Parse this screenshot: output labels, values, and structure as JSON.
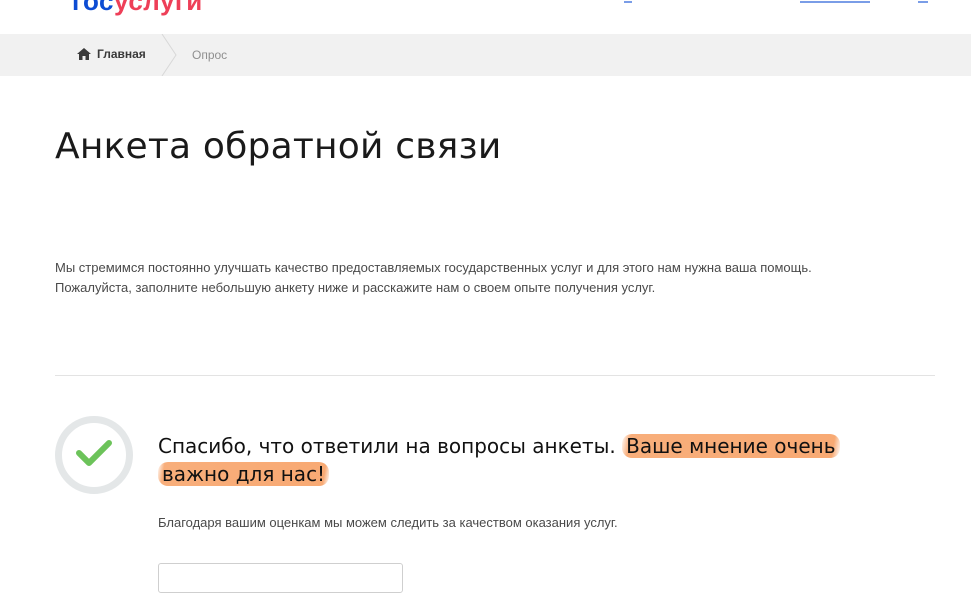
{
  "header": {
    "logo_part1": "гос",
    "logo_part2": "услуги"
  },
  "breadcrumb": {
    "home_label": "Главная",
    "current_label": "Опрос"
  },
  "main": {
    "title": "Анкета обратной связи",
    "intro_line1": "Мы стремимся постоянно улучшать качество предоставляемых государственных услуг и для этого нам нужна ваша помощь.",
    "intro_line2": "Пожалуйста, заполните небольшую анкету ниже и расскажите нам о своем опыте получения услуг."
  },
  "success": {
    "heading_plain": "Спасибо, что ответили на вопросы анкеты. ",
    "heading_highlight_1": "Ваше мнение очень",
    "heading_highlight_2": "важно для нас!",
    "subtext": "Благодаря вашим оценкам мы можем следить за качеством оказания услуг."
  },
  "icons": {
    "home": "home-icon",
    "check": "check-icon",
    "separator": "chevron-right-icon"
  },
  "colors": {
    "brand_blue": "#0d4cd3",
    "brand_red": "#ee3f58",
    "check_green": "#6cc35a",
    "highlight_orange": "#f7a064",
    "breadcrumb_bg": "#f1f1f1"
  }
}
